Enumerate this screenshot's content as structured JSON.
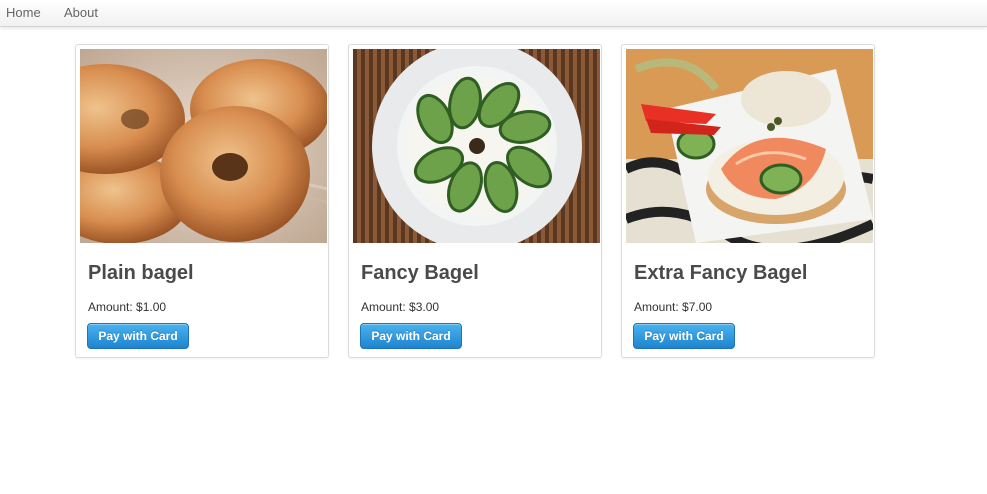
{
  "nav": {
    "home_label": "Home",
    "about_label": "About"
  },
  "products": [
    {
      "title": "Plain bagel",
      "amount": "Amount: $1.00",
      "button_label": "Pay with Card"
    },
    {
      "title": "Fancy Bagel",
      "amount": "Amount: $3.00",
      "button_label": "Pay with Card"
    },
    {
      "title": "Extra Fancy Bagel",
      "amount": "Amount: $7.00",
      "button_label": "Pay with Card"
    }
  ],
  "colors": {
    "button": "#1e84d0",
    "title": "#4a4a4a"
  }
}
